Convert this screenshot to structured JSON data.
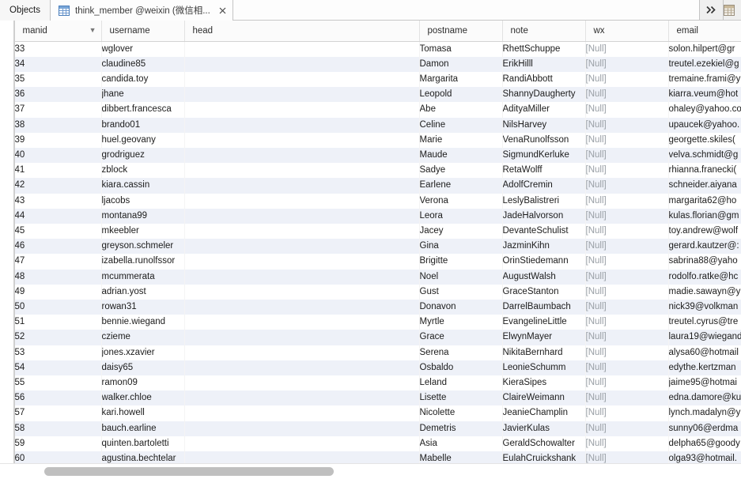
{
  "tabbar": {
    "objects_tab_label": "Objects",
    "active_tab_label": "think_member @weixin (微信相...",
    "active_tab_icon": "table-grid-icon",
    "close_icon": "close-icon",
    "overflow_icon": "double-chevron-right-icon",
    "end_icon": "table-grid-icon"
  },
  "grid": {
    "columns": [
      {
        "key": "manid",
        "label": "manid",
        "has_sort_chevron": true
      },
      {
        "key": "username",
        "label": "username",
        "has_sort_chevron": false
      },
      {
        "key": "head",
        "label": "head",
        "has_sort_chevron": false
      },
      {
        "key": "postname",
        "label": "postname",
        "has_sort_chevron": false
      },
      {
        "key": "note",
        "label": "note",
        "has_sort_chevron": false
      },
      {
        "key": "wx",
        "label": "wx",
        "has_sort_chevron": false
      },
      {
        "key": "email",
        "label": "email",
        "has_sort_chevron": false
      }
    ],
    "null_text": "[Null]",
    "rows": [
      {
        "manid": "33",
        "username": "wglover",
        "head": "",
        "postname": "Tomasa",
        "note": "RhettSchuppe",
        "wx": "[Null]",
        "email": "solon.hilpert@gr"
      },
      {
        "manid": "34",
        "username": "claudine85",
        "head": "",
        "postname": "Damon",
        "note": "ErikHilll",
        "wx": "[Null]",
        "email": "treutel.ezekiel@g"
      },
      {
        "manid": "35",
        "username": "candida.toy",
        "head": "",
        "postname": "Margarita",
        "note": "RandiAbbott",
        "wx": "[Null]",
        "email": "tremaine.frami@y"
      },
      {
        "manid": "36",
        "username": "jhane",
        "head": "",
        "postname": "Leopold",
        "note": "ShannyDaugherty",
        "wx": "[Null]",
        "email": "kiarra.veum@hot"
      },
      {
        "manid": "37",
        "username": "dibbert.francesca",
        "head": "",
        "postname": "Abe",
        "note": "AdityaMiller",
        "wx": "[Null]",
        "email": "ohaley@yahoo.co"
      },
      {
        "manid": "38",
        "username": "brando01",
        "head": "",
        "postname": "Celine",
        "note": "NilsHarvey",
        "wx": "[Null]",
        "email": "upaucek@yahoo."
      },
      {
        "manid": "39",
        "username": "huel.geovany",
        "head": "",
        "postname": "Marie",
        "note": "VenaRunolfsson",
        "wx": "[Null]",
        "email": "georgette.skiles("
      },
      {
        "manid": "40",
        "username": "grodriguez",
        "head": "",
        "postname": "Maude",
        "note": "SigmundKerluke",
        "wx": "[Null]",
        "email": "velva.schmidt@g"
      },
      {
        "manid": "41",
        "username": "zblock",
        "head": "",
        "postname": "Sadye",
        "note": "RetaWolff",
        "wx": "[Null]",
        "email": "rhianna.franecki("
      },
      {
        "manid": "42",
        "username": "kiara.cassin",
        "head": "",
        "postname": "Earlene",
        "note": "AdolfCremin",
        "wx": "[Null]",
        "email": "schneider.aiyana"
      },
      {
        "manid": "43",
        "username": "ljacobs",
        "head": "",
        "postname": "Verona",
        "note": "LeslyBalistreri",
        "wx": "[Null]",
        "email": "margarita62@ho"
      },
      {
        "manid": "44",
        "username": "montana99",
        "head": "",
        "postname": "Leora",
        "note": "JadeHalvorson",
        "wx": "[Null]",
        "email": "kulas.florian@gm"
      },
      {
        "manid": "45",
        "username": "mkeebler",
        "head": "",
        "postname": "Jacey",
        "note": "DevanteSchulist",
        "wx": "[Null]",
        "email": "toy.andrew@wolf"
      },
      {
        "manid": "46",
        "username": "greyson.schmeler",
        "head": "",
        "postname": "Gina",
        "note": "JazminKihn",
        "wx": "[Null]",
        "email": "gerard.kautzer@:"
      },
      {
        "manid": "47",
        "username": "izabella.runolfssor",
        "head": "",
        "postname": "Brigitte",
        "note": "OrinStiedemann",
        "wx": "[Null]",
        "email": "sabrina88@yaho"
      },
      {
        "manid": "48",
        "username": "mcummerata",
        "head": "",
        "postname": "Noel",
        "note": "AugustWalsh",
        "wx": "[Null]",
        "email": "rodolfo.ratke@hc"
      },
      {
        "manid": "49",
        "username": "adrian.yost",
        "head": "",
        "postname": "Gust",
        "note": "GraceStanton",
        "wx": "[Null]",
        "email": "madie.sawayn@y"
      },
      {
        "manid": "50",
        "username": "rowan31",
        "head": "",
        "postname": "Donavon",
        "note": "DarrelBaumbach",
        "wx": "[Null]",
        "email": "nick39@volkman"
      },
      {
        "manid": "51",
        "username": "bennie.wiegand",
        "head": "",
        "postname": "Myrtle",
        "note": "EvangelineLittle",
        "wx": "[Null]",
        "email": "treutel.cyrus@tre"
      },
      {
        "manid": "52",
        "username": "czieme",
        "head": "",
        "postname": "Grace",
        "note": "ElwynMayer",
        "wx": "[Null]",
        "email": "laura19@wiegand"
      },
      {
        "manid": "53",
        "username": "jones.xzavier",
        "head": "",
        "postname": "Serena",
        "note": "NikitaBernhard",
        "wx": "[Null]",
        "email": "alysa60@hotmail"
      },
      {
        "manid": "54",
        "username": "daisy65",
        "head": "",
        "postname": "Osbaldo",
        "note": "LeonieSchumm",
        "wx": "[Null]",
        "email": "edythe.kertzman"
      },
      {
        "manid": "55",
        "username": "ramon09",
        "head": "",
        "postname": "Leland",
        "note": "KieraSipes",
        "wx": "[Null]",
        "email": "jaime95@hotmai"
      },
      {
        "manid": "56",
        "username": "walker.chloe",
        "head": "",
        "postname": "Lisette",
        "note": "ClaireWeimann",
        "wx": "[Null]",
        "email": "edna.damore@ku"
      },
      {
        "manid": "57",
        "username": "kari.howell",
        "head": "",
        "postname": "Nicolette",
        "note": "JeanieChamplin",
        "wx": "[Null]",
        "email": "lynch.madalyn@y"
      },
      {
        "manid": "58",
        "username": "bauch.earline",
        "head": "",
        "postname": "Demetris",
        "note": "JavierKulas",
        "wx": "[Null]",
        "email": "sunny06@erdma"
      },
      {
        "manid": "59",
        "username": "quinten.bartoletti",
        "head": "",
        "postname": "Asia",
        "note": "GeraldSchowalter",
        "wx": "[Null]",
        "email": "delpha65@goody"
      },
      {
        "manid": "60",
        "username": "agustina.bechtelar",
        "head": "",
        "postname": "Mabelle",
        "note": "EulahCruickshank",
        "wx": "[Null]",
        "email": "olga93@hotmail."
      }
    ]
  },
  "scrollbar": {
    "orientation": "horizontal",
    "thumb_name": "horizontal-scrollbar-thumb"
  },
  "colors": {
    "row_stripe": "#eef1f8",
    "null_text": "#9aa0a6",
    "tab_icon_blue": "#4a7ebb"
  }
}
